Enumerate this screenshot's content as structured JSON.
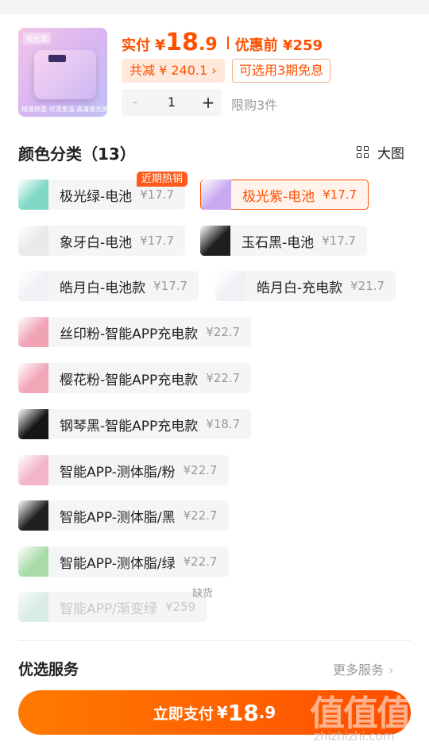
{
  "header": {
    "thumb_tag": "极光紫",
    "thumb_brand": "",
    "thumb_features": "精准称重  可测室温  高清夜光屏",
    "price_label": "实付",
    "currency": "¥",
    "price_int": "18",
    "price_dec": ".9",
    "original_price": "优惠前 ¥259",
    "saving_chip": "共减 ¥ 240.1 ›",
    "installment_chip": "可选用3期免息",
    "qty_minus": "-",
    "quantity": "1",
    "qty_plus": "+",
    "limit_text": "限购3件"
  },
  "colors_section": {
    "title": "颜色分类（13）",
    "big_view_label": "大图",
    "hot_badge": "近期热销",
    "out_of_stock_badge": "缺货",
    "options": [
      {
        "name": "极光绿-电池",
        "price": "¥17.7",
        "swatch": "#7fd9c6",
        "selected": false,
        "disabled": false
      },
      {
        "name": "极光紫-电池",
        "price": "¥17.7",
        "swatch": "#c9a9f0",
        "selected": true,
        "disabled": false
      },
      {
        "name": "象牙白-电池",
        "price": "¥17.7",
        "swatch": "#e9e9e9",
        "selected": false,
        "disabled": false
      },
      {
        "name": "玉石黑-电池",
        "price": "¥17.7",
        "swatch": "#1e1e1e",
        "selected": false,
        "disabled": false
      },
      {
        "name": "皓月白-电池款",
        "price": "¥17.7",
        "swatch": "#f2f0f5",
        "selected": false,
        "disabled": false
      },
      {
        "name": "皓月白-充电款",
        "price": "¥21.7",
        "swatch": "#f2f0f5",
        "selected": false,
        "disabled": false
      },
      {
        "name": "丝印粉-智能APP充电款",
        "price": "¥22.7",
        "swatch": "#f0a3b4",
        "selected": false,
        "disabled": false
      },
      {
        "name": "樱花粉-智能APP充电款",
        "price": "¥22.7",
        "swatch": "#f2a7b8",
        "selected": false,
        "disabled": false
      },
      {
        "name": "钢琴黑-智能APP充电款",
        "price": "¥18.7",
        "swatch": "#161616",
        "selected": false,
        "disabled": false
      },
      {
        "name": "智能APP-测体脂/粉",
        "price": "¥22.7",
        "swatch": "#f3b6c8",
        "selected": false,
        "disabled": false
      },
      {
        "name": "智能APP-测体脂/黑",
        "price": "¥22.7",
        "swatch": "#202020",
        "selected": false,
        "disabled": false
      },
      {
        "name": "智能APP-测体脂/绿",
        "price": "¥22.7",
        "swatch": "#a9dca8",
        "selected": false,
        "disabled": false
      },
      {
        "name": "智能APP/渐变绿",
        "price": "¥259",
        "swatch": "#b8e3d2",
        "selected": false,
        "disabled": true
      }
    ]
  },
  "services": {
    "title": "优选服务",
    "more": "更多服务"
  },
  "pay_button": {
    "label": "立即支付",
    "currency": "¥",
    "int": "18",
    "dec": ".9"
  },
  "watermark": {
    "text": "值值值",
    "domain": "zhizhizhi.com"
  }
}
